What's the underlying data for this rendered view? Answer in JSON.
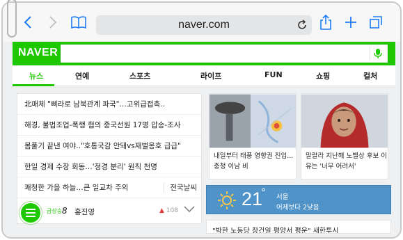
{
  "browser": {
    "url": "naver.com"
  },
  "naver": {
    "logo": "NAVER"
  },
  "tabs": [
    "뉴스",
    "연예",
    "스포츠",
    "라이프",
    "FUN",
    "쇼핑",
    "컬처"
  ],
  "news": [
    "北매체 \"삐라로 남북관계 파국\"…고위급접촉..",
    "해경, 불법조업-폭행 혐의 중국선원 17명 압송-조사",
    "몸풀기 끝낸 여야..\"호통국감 안돼vs재벌옹호 급급\"",
    "한일 경제 수장 회동…'정경 분리' 원칙 천명",
    "쾌청한 가을 하늘…큰 일교차 주의"
  ],
  "news_side_link": "전국날씨",
  "ranking": {
    "badge": "급상승",
    "number": "8",
    "name": "홍진영",
    "change": "108"
  },
  "photo_news": [
    {
      "line1": "내일부터 태풍 영향권 진입...",
      "line2": "충청 이남 비"
    },
    {
      "line1": "말랄라 지난해 노벨상 후보 이",
      "line2": "유는 '너무 어려서'"
    }
  ],
  "weather": {
    "temperature": "21",
    "unit": "°",
    "city": "서울",
    "compare": "어제보다 2낮음"
  },
  "bottom_headline": "\"박한 노동당 창건일 평양서 평운\"  새한투시"
}
